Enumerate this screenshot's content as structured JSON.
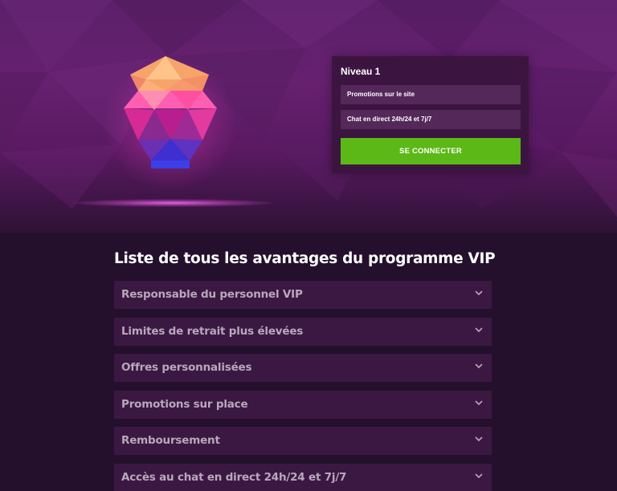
{
  "hero": {
    "icons": {
      "gem": "crowned-gem-icon"
    }
  },
  "level_card": {
    "title": "Niveau 1",
    "perks": [
      "Promotions sur le site",
      "Chat en direct 24h/24 et 7j/7"
    ],
    "connect_label": "SE CONNECTER"
  },
  "benefits": {
    "title": "Liste de tous les avantages du programme VIP",
    "expand_icon": "chevron-down-icon",
    "items": [
      "Responsable du personnel VIP",
      "Limites de retrait plus élevées",
      "Offres personnalisées",
      "Promotions sur place",
      "Remboursement",
      "Accès au chat en direct 24h/24 et 7j/7"
    ]
  },
  "colors": {
    "background": "#24102c",
    "hero": "#62206c",
    "card": "#3b1540",
    "perk": "#55285a",
    "button": "#5cb816",
    "accordion": "#3b1841",
    "accordion_text": "#b8a8bc"
  }
}
